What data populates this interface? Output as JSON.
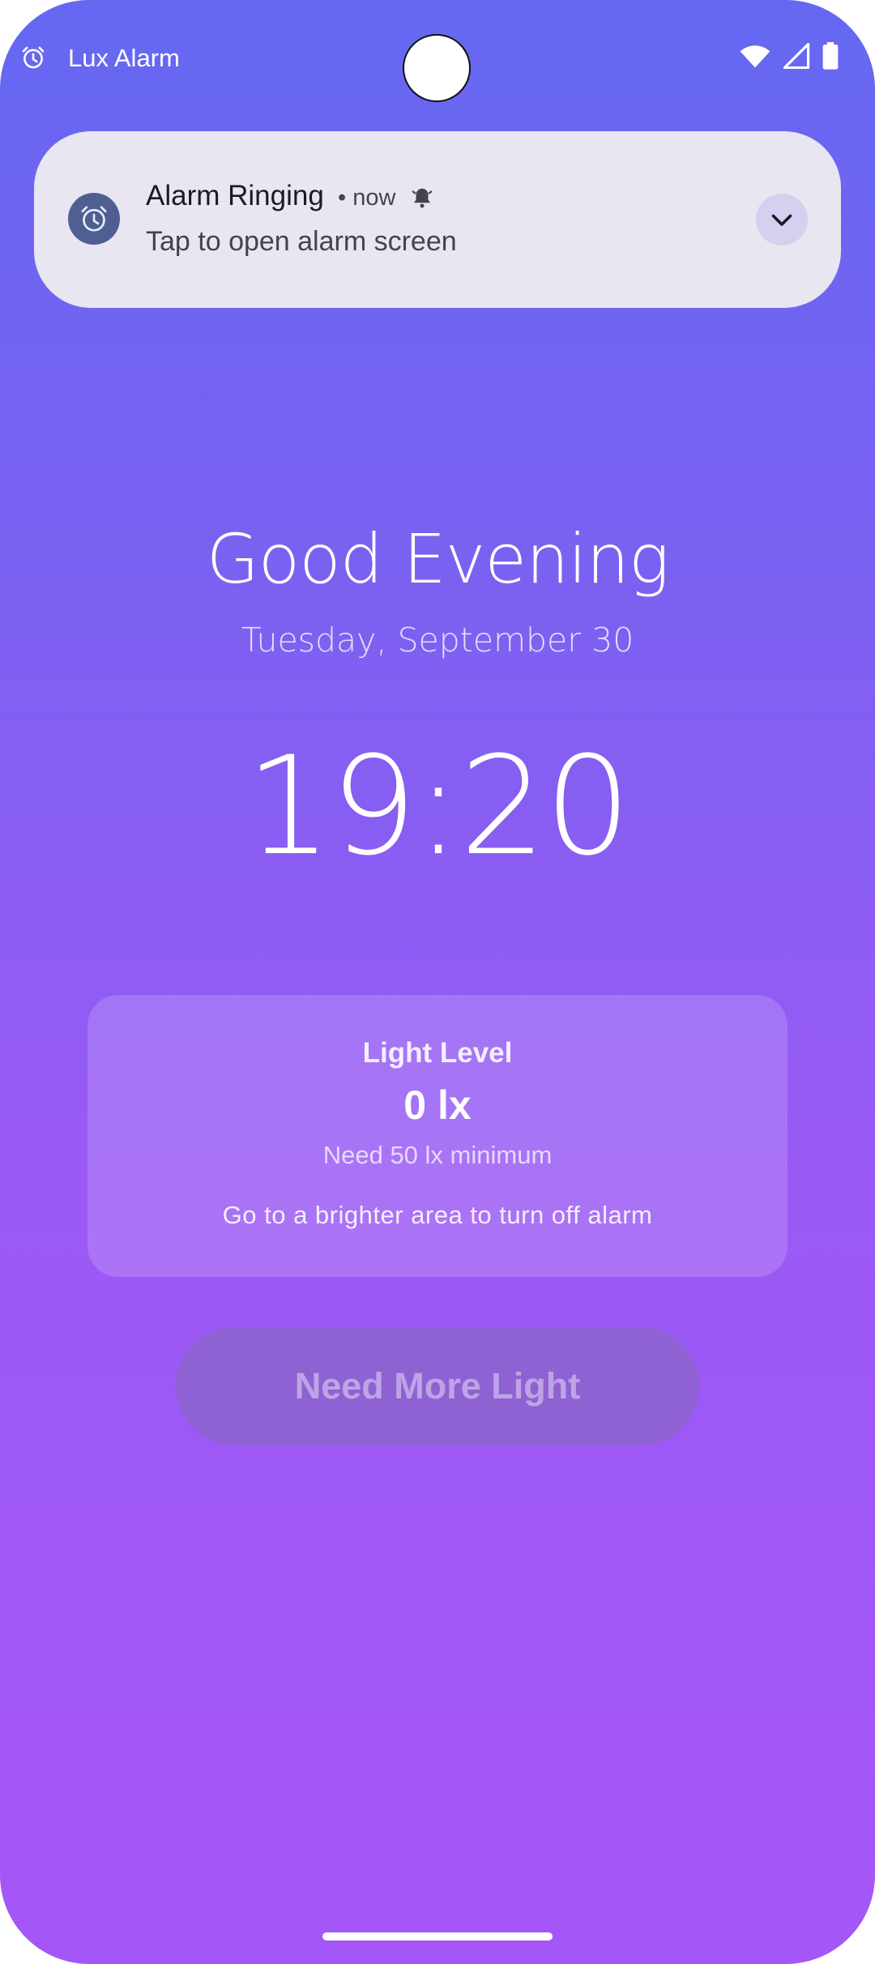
{
  "status_bar": {
    "app_name": "Lux Alarm",
    "icons": [
      "alarm-icon",
      "wifi-icon",
      "signal-icon",
      "battery-icon"
    ]
  },
  "notification": {
    "title": "Alarm Ringing",
    "meta": "• now",
    "body": "Tap to open alarm screen",
    "icons": [
      "alarm-clock-icon",
      "bell-icon",
      "chevron-down-icon"
    ]
  },
  "main": {
    "greeting": "Good Evening",
    "date": "Tuesday, September 30",
    "time": "19:20"
  },
  "light_card": {
    "label": "Light Level",
    "value": "0 lx",
    "requirement": "Need 50 lx minimum",
    "hint": "Go to a brighter area to turn off alarm"
  },
  "button": {
    "label": "Need More Light"
  },
  "colors": {
    "background_top": "#6568f1",
    "background_bottom": "#a556f6",
    "notification_bg": "#e8e6f0",
    "notification_icon_bg": "#4f5f92"
  }
}
